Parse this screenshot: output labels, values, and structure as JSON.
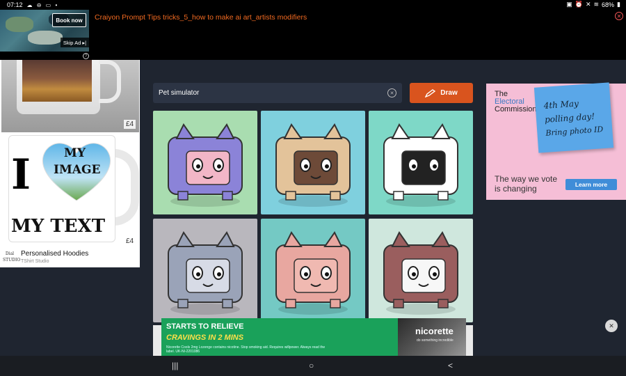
{
  "status_bar": {
    "time": "07:12",
    "battery": "68%",
    "left_icons": [
      "cloud-icon",
      "dnd-icon",
      "window-icon",
      "dot-icon"
    ],
    "right_icons": [
      "lock-icon",
      "alarm-icon",
      "mute-icon",
      "wifi-icon",
      "battery-icon"
    ]
  },
  "top_ad": {
    "book_now": "Book now",
    "skip_ad": "Skip Ad",
    "info": "?",
    "title": "Craiyon Prompt Tips tricks_5_how to make ai art_artists modifiers"
  },
  "left_ad": {
    "price_1": "£4",
    "price_2": "£4",
    "mug_big_letter": "I",
    "mug_heart_line1": "MY",
    "mug_heart_line2": "IMAGE",
    "mug_bottom_text": "MY TEXT",
    "shop_logo": "Dial STUDIO",
    "product_title": "Personalised Hoodies",
    "shop_name": "TShirt Studio"
  },
  "search": {
    "value": "Pet simulator",
    "draw_label": "Draw"
  },
  "results": [
    {
      "name": "purple-cat-pet",
      "bg": "#a9ddb0",
      "body": "#8b83d8",
      "face": "#f2b6c7"
    },
    {
      "name": "tan-dog-pet",
      "bg": "#7fd0de",
      "body": "#e3c39a",
      "face": "#6d4a38"
    },
    {
      "name": "panda-pet",
      "bg": "#7ed8c7",
      "body": "#ffffff",
      "face": "#222222"
    },
    {
      "name": "gray-elephant-pet",
      "bg": "#b9b7bd",
      "body": "#9aa3b8",
      "face": "#d7dbe6"
    },
    {
      "name": "pink-cat-pet",
      "bg": "#74c9c4",
      "body": "#e8a7a0",
      "face": "#f0b9b1"
    },
    {
      "name": "brown-box-pet",
      "bg": "#cfe7dd",
      "body": "#9a5e5e",
      "face": "#f7f7f7"
    }
  ],
  "right_ad": {
    "org_line1": "The",
    "org_line2": "Electoral",
    "org_line3": "Commission",
    "note_line1": "4th May",
    "note_line2": "polling day!",
    "note_line3": "Bring photo ID",
    "tagline_1": "The way we vote",
    "tagline_2": "is changing",
    "cta": "Learn more"
  },
  "bottom_ad": {
    "headline": "STARTS TO RELIEVE",
    "subline": "CRAVINGS IN 2 MINS",
    "fine_print": "Nicorette Cools 2mg Lozenge contains nicotine. Stop smoking aid. Requires willpower. Always read the label. UK-NI-2201086",
    "brand": "nicorette",
    "brand_tag": "do something incredible"
  },
  "nav": {
    "recent": "|||",
    "home": "○",
    "back": "<"
  },
  "colors": {
    "accent": "#d9541e",
    "ad_title": "#f26a21",
    "page_bg": "#1f2530"
  }
}
